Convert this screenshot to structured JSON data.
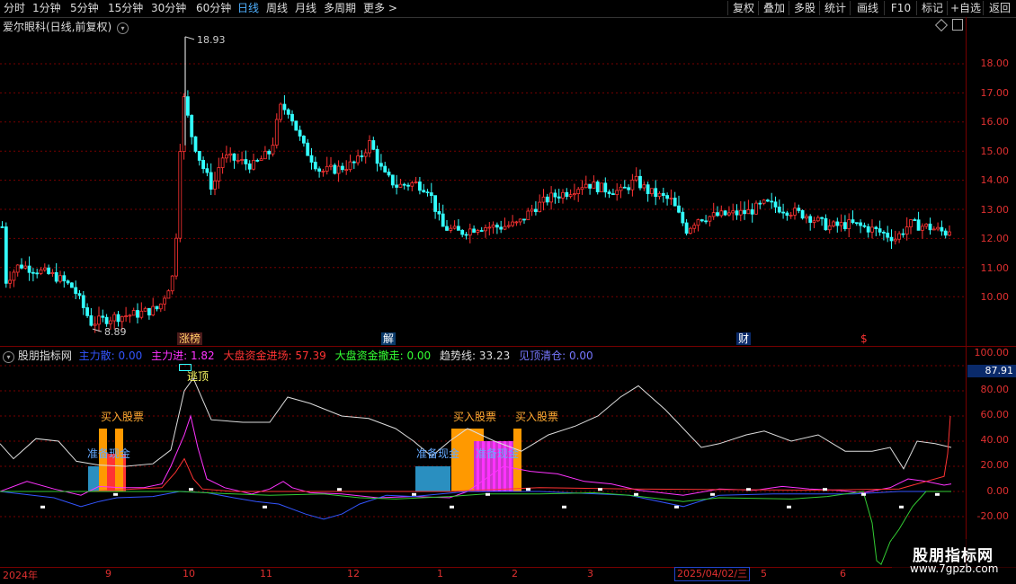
{
  "toolbar": {
    "timeframes": [
      "分时",
      "1分钟",
      "5分钟",
      "15分钟",
      "30分钟",
      "60分钟",
      "日线",
      "周线",
      "月线",
      "多周期",
      "更多 >"
    ],
    "active": "日线",
    "right_buttons": [
      "复权",
      "叠加",
      "多股",
      "统计",
      "画线",
      "F10",
      "标记",
      "+自选",
      "返回"
    ]
  },
  "main": {
    "title": "爱尔眼科(日线,前复权)",
    "y_labels": [
      "18.00",
      "17.00",
      "16.00",
      "15.00",
      "14.00",
      "13.00",
      "12.00",
      "11.00",
      "10.00"
    ],
    "high_label": "18.93",
    "low_label": "8.89",
    "events": [
      {
        "text": "涨榜",
        "color": "#ffcc66",
        "bg": "#4a1a1a"
      },
      {
        "text": "解",
        "color": "#fff",
        "bg": "#0a3a6a"
      },
      {
        "text": "财",
        "color": "#fff",
        "bg": "#0a2a6a"
      },
      {
        "text": "$",
        "color": "#ff3333",
        "bg": "#000"
      }
    ]
  },
  "indicator": {
    "name": "股朋指标网",
    "params": [
      {
        "label": "主力散:",
        "value": "0.00",
        "color": "#3355ff"
      },
      {
        "label": "主力进:",
        "value": "1.82",
        "color": "#ff33ff"
      },
      {
        "label": "大盘资金进场:",
        "value": "57.39",
        "color": "#ff3333"
      },
      {
        "label": "大盘资金撤走:",
        "value": "0.00",
        "color": "#33ff33"
      },
      {
        "label": "趋势线:",
        "value": "33.23",
        "color": "#dddddd"
      },
      {
        "label": "见顶清仓:",
        "value": "0.00",
        "color": "#7777ff"
      }
    ],
    "y_labels": [
      "100.00",
      "80.00",
      "60.00",
      "40.00",
      "20.00",
      "0.00",
      "-20.00"
    ],
    "current_value": "87.91",
    "annotations": {
      "escape_top": "逃顶",
      "buy": "买入股票",
      "prepare": "准备现金"
    }
  },
  "xaxis": {
    "labels": [
      "2024年",
      "9",
      "10",
      "11",
      "12",
      "1",
      "2",
      "3",
      "2025/04/02/三",
      "5",
      "6"
    ]
  },
  "watermark": {
    "title": "股朋指标网",
    "url": "www.7gpzb.com"
  },
  "colors": {
    "up": "#ff3333",
    "down": "#33ffff",
    "bg": "#000000",
    "grid": "#700000",
    "active": "#4fb0ff"
  }
}
